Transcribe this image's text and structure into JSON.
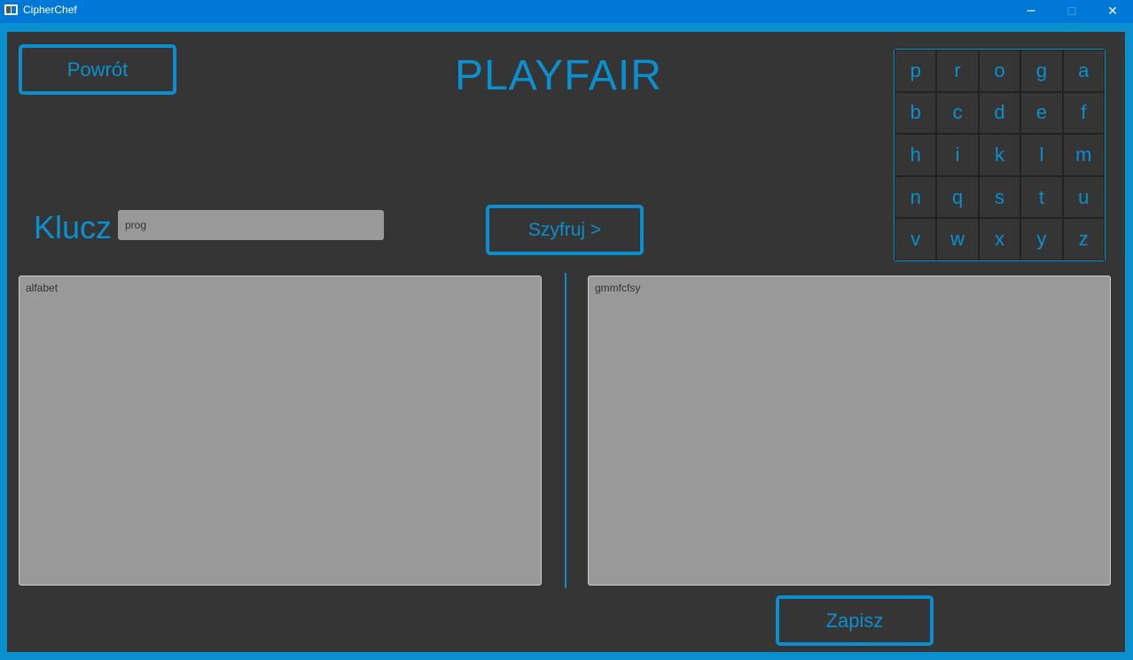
{
  "window": {
    "title": "CipherChef",
    "minimize": "─",
    "maximize": "☐",
    "close": "✕"
  },
  "header": {
    "back_label": "Powrót",
    "title": "PLAYFAIR"
  },
  "key": {
    "label": "Klucz",
    "value": "prog"
  },
  "encrypt_label": "Szyfruj >",
  "save_label": "Zapisz",
  "grid": [
    [
      "p",
      "r",
      "o",
      "g",
      "a"
    ],
    [
      "b",
      "c",
      "d",
      "e",
      "f"
    ],
    [
      "h",
      "i",
      "k",
      "l",
      "m"
    ],
    [
      "n",
      "q",
      "s",
      "t",
      "u"
    ],
    [
      "v",
      "w",
      "x",
      "y",
      "z"
    ]
  ],
  "input_text": "alfabet",
  "output_text": "gmmfcfsy",
  "colors": {
    "accent": "#0a8fcf",
    "background": "#353535",
    "field": "#999999",
    "titlebar": "#0078d7"
  }
}
